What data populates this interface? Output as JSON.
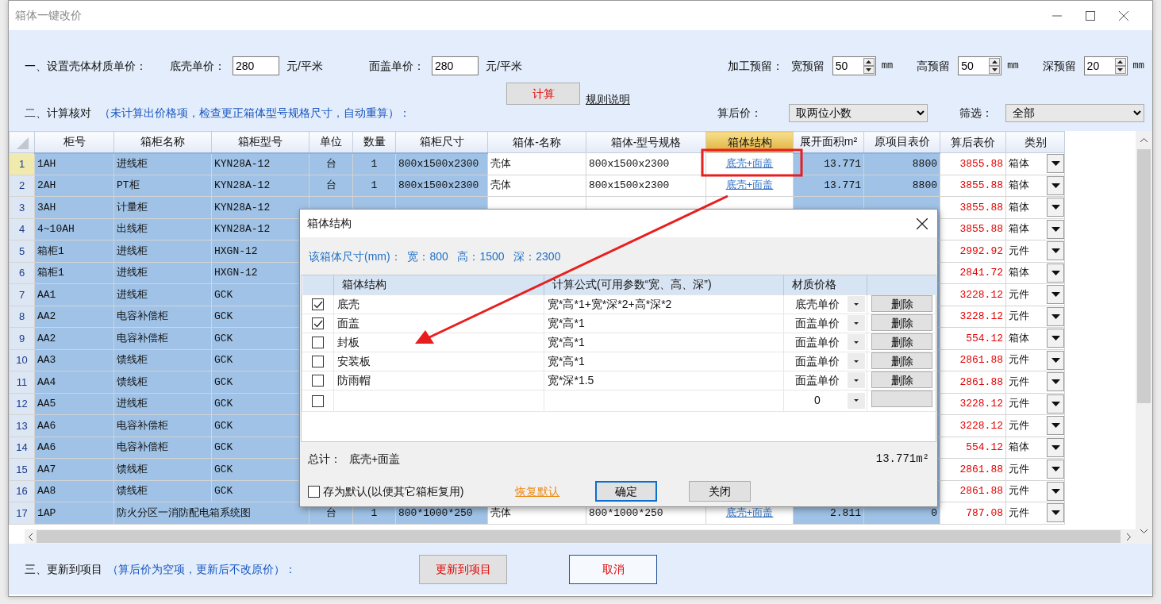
{
  "window": {
    "title": "箱体一键改价"
  },
  "material_prices": {
    "label": "一、设置壳体材质单价：",
    "fields": [
      {
        "label": "底壳单价：",
        "value": "280",
        "unit": "元/平米"
      },
      {
        "label": "面盖单价：",
        "value": "280",
        "unit": "元/平米"
      }
    ]
  },
  "allowance": {
    "label": "加工预留：",
    "fields": [
      {
        "label": "宽预留",
        "value": "50",
        "unit": "mm"
      },
      {
        "label": "高预留",
        "value": "50",
        "unit": "mm"
      },
      {
        "label": "深预留",
        "value": "20",
        "unit": "mm"
      }
    ]
  },
  "calculate_button": "计算",
  "rules_link": "规则说明",
  "check": {
    "label": "二、计算核对",
    "hint": "（未计算出价格项，检查更正箱体型号规格尺寸，自动重算）："
  },
  "rounding": {
    "label": "算后价：",
    "value": "取两位小数"
  },
  "filter": {
    "label": "筛选：",
    "value": "全部"
  },
  "table": {
    "columns": [
      {
        "label": "柜号",
        "selected": true,
        "active": false
      },
      {
        "label": "箱柜名称",
        "selected": true,
        "active": false
      },
      {
        "label": "箱柜型号",
        "selected": true,
        "active": false
      },
      {
        "label": "单位",
        "selected": true,
        "active": false
      },
      {
        "label": "数量",
        "selected": true,
        "active": false
      },
      {
        "label": "箱柜尺寸",
        "selected": true,
        "active": false
      },
      {
        "label": "箱体-名称",
        "selected": false,
        "active": false
      },
      {
        "label": "箱体-型号规格",
        "selected": false,
        "active": false
      },
      {
        "label": "箱体结构",
        "selected": false,
        "active": true
      },
      {
        "label": "展开面积m²",
        "selected": true,
        "active": false
      },
      {
        "label": "原项目表价",
        "selected": true,
        "active": false
      },
      {
        "label": "算后表价",
        "selected": false,
        "active": false
      },
      {
        "label": "类别",
        "selected": false,
        "active": false
      }
    ],
    "rows": [
      {
        "number": "1",
        "selected": true,
        "no": "1AH",
        "name": "进线柜",
        "model": "KYN28A-12",
        "unit": "台",
        "qty": "1",
        "size": "800x1500x2300",
        "box_name": "壳体",
        "box_spec": "800x1500x2300",
        "structure": "底壳+面盖",
        "area": "13.771",
        "original_price": "8800",
        "new_price": "3855.88",
        "category": "箱体"
      },
      {
        "number": "2",
        "selected": false,
        "no": "2AH",
        "name": "PT柜",
        "model": "KYN28A-12",
        "unit": "台",
        "qty": "1",
        "size": "800x1500x2300",
        "box_name": "壳体",
        "box_spec": "800x1500x2300",
        "structure": "底壳+面盖",
        "area": "13.771",
        "original_price": "8800",
        "new_price": "3855.88",
        "category": "箱体"
      },
      {
        "number": "3",
        "selected": false,
        "no": "3AH",
        "name": "计量柜",
        "model": "KYN28A-12",
        "new_price": "3855.88",
        "category": "箱体"
      },
      {
        "number": "4",
        "selected": false,
        "no": "4~10AH",
        "name": "出线柜",
        "model": "KYN28A-12",
        "new_price": "3855.88",
        "category": "箱体"
      },
      {
        "number": "5",
        "selected": false,
        "no": "箱柜1",
        "name": "进线柜",
        "model": "HXGN-12",
        "new_price": "2992.92",
        "category": "元件"
      },
      {
        "number": "6",
        "selected": false,
        "no": "箱柜1",
        "name": "进线柜",
        "model": "HXGN-12",
        "new_price": "2841.72",
        "category": "箱体"
      },
      {
        "number": "7",
        "selected": false,
        "no": "AA1",
        "name": "进线柜",
        "model": "GCK",
        "new_price": "3228.12",
        "category": "元件"
      },
      {
        "number": "8",
        "selected": false,
        "no": "AA2",
        "name": "电容补偿柜",
        "model": "GCK",
        "new_price": "3228.12",
        "category": "元件"
      },
      {
        "number": "9",
        "selected": false,
        "no": "AA2",
        "name": "电容补偿柜",
        "model": "GCK",
        "new_price": "554.12",
        "category": "箱体"
      },
      {
        "number": "10",
        "selected": false,
        "no": "AA3",
        "name": "馈线柜",
        "model": "GCK",
        "new_price": "2861.88",
        "category": "元件"
      },
      {
        "number": "11",
        "selected": false,
        "no": "AA4",
        "name": "馈线柜",
        "model": "GCK",
        "new_price": "2861.88",
        "category": "元件"
      },
      {
        "number": "12",
        "selected": false,
        "no": "AA5",
        "name": "进线柜",
        "model": "GCK",
        "new_price": "3228.12",
        "category": "元件"
      },
      {
        "number": "13",
        "selected": false,
        "no": "AA6",
        "name": "电容补偿柜",
        "model": "GCK",
        "new_price": "3228.12",
        "category": "元件"
      },
      {
        "number": "14",
        "selected": false,
        "no": "AA6",
        "name": "电容补偿柜",
        "model": "GCK",
        "new_price": "554.12",
        "category": "箱体"
      },
      {
        "number": "15",
        "selected": false,
        "no": "AA7",
        "name": "馈线柜",
        "model": "GCK",
        "new_price": "2861.88",
        "category": "元件"
      },
      {
        "number": "16",
        "selected": false,
        "no": "AA8",
        "name": "馈线柜",
        "model": "GCK",
        "new_price": "2861.88",
        "category": "元件"
      },
      {
        "number": "17",
        "selected": false,
        "no": "1AP",
        "name": "防火分区一消防配电箱系统图",
        "unit": "台",
        "qty": "1",
        "size": "800*1000*250",
        "box_name": "壳体",
        "box_spec": "800*1000*250",
        "structure": "底壳+面盖",
        "area": "2.811",
        "original_price": "0",
        "new_price": "787.08",
        "category": "元件"
      }
    ]
  },
  "update": {
    "label": "三、更新到项目",
    "hint": "（算后价为空项，更新后不改原价）：",
    "update_button": "更新到项目",
    "cancel_button": "取消"
  },
  "dialog": {
    "title": "箱体结构",
    "size_info": "该箱体尺寸(mm)：  宽：800   高：1500   深：2300",
    "columns": [
      "箱体结构",
      "计算公式(可用参数“宽、高、深”)",
      "材质价格"
    ],
    "rows": [
      {
        "checked": true,
        "part": "底壳",
        "formula": "宽*高*1+宽*深*2+高*深*2",
        "material": "底壳单价",
        "delete": "删除"
      },
      {
        "checked": true,
        "part": "面盖",
        "formula": "宽*高*1",
        "material": "面盖单价",
        "delete": "删除"
      },
      {
        "checked": false,
        "part": "封板",
        "formula": "宽*高*1",
        "material": "面盖单价",
        "delete": "删除"
      },
      {
        "checked": false,
        "part": "安装板",
        "formula": "宽*高*1",
        "material": "面盖单价",
        "delete": "删除"
      },
      {
        "checked": false,
        "part": "防雨帽",
        "formula": "宽*深*1.5",
        "material": "面盖单价",
        "delete": "删除"
      },
      {
        "checked": false,
        "material": "0"
      }
    ],
    "total_label": "总计：",
    "total_parts": "底壳+面盖",
    "total_area": "13.771m²",
    "save_default": {
      "label": "存为默认(以便其它箱柜复用)",
      "checked": false
    },
    "restore_link": "恢复默认",
    "ok_button": "确定",
    "close_button": "关闭"
  }
}
